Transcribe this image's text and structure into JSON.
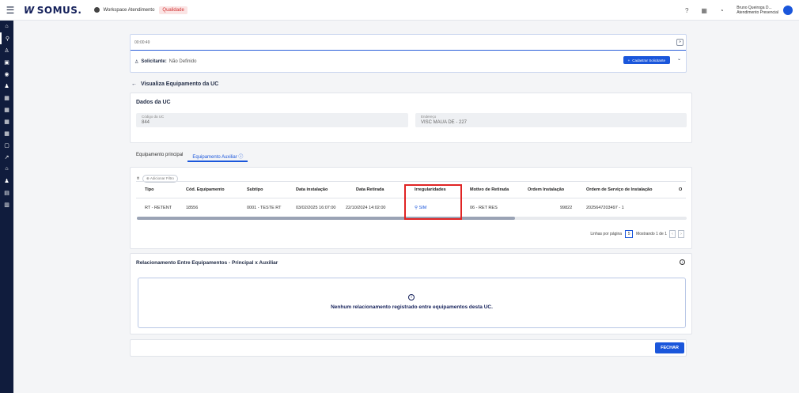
{
  "topbar": {
    "logo_mark": "W",
    "logo_text": "SOMUS.",
    "workspace": "Workspace Atendimento",
    "badge": "Qualidade",
    "user_name": "Bruno Queiroga D...",
    "user_role": "Atendimento Presencial"
  },
  "sidebar": {
    "icons": [
      "home-icon",
      "search-icon",
      "users-icon",
      "clipboard-icon",
      "money-icon",
      "people-icon",
      "grid-icon",
      "grid-icon",
      "grid-icon",
      "grid-icon",
      "document-icon",
      "route-icon",
      "home-icon",
      "people-icon",
      "list-icon",
      "card-icon"
    ]
  },
  "timer": {
    "value": "00:00:49"
  },
  "solicitante": {
    "label": "Solicitante:",
    "value": "Não Definido",
    "button": "Cadastrar Solicitante"
  },
  "page": {
    "title": "Visualiza Equipamento da UC"
  },
  "dados": {
    "title": "Dados da UC",
    "codigo_label": "Código da UC",
    "codigo_value": "844",
    "endereco_label": "Endereço",
    "endereco_value": "VISC MAUA DE - 227"
  },
  "tabs": {
    "principal": "Equipamento principal",
    "auxiliar": "Equipamento Auxiliar"
  },
  "table": {
    "filter_label": "Adicionar Filtro",
    "headers": [
      "Tipo",
      "Cód. Equipamento",
      "Subtipo",
      "Data instalação",
      "Data Retirada",
      "Irregularidades",
      "Motivo de Retirada",
      "Ordem Instalação",
      "Ordem de Serviço de Instalação",
      "O"
    ],
    "row": {
      "tipo": "RT - RETENT",
      "codigo": "18556",
      "subtipo": "0001 - TESTE RT",
      "data_instalacao": "03/02/2025 16:07:00",
      "data_retirada": "22/10/2024 14:02:00",
      "irregularidades": "SIM",
      "motivo": "06 - RET RES",
      "ordem_instalacao": "99822",
      "ordem_servico": "2025647203497 - 1"
    },
    "rows_per_page_label": "Linhas por página",
    "rows_per_page": "5",
    "showing": "Mostrando 1 de 1"
  },
  "relacionamento": {
    "title": "Relacionamento Entre Equipamentos - Principal x Auxiliar",
    "empty_message": "Nenhum relacionamento registrado entre equipamentos desta UC."
  },
  "footer": {
    "close_button": "FECHAR"
  }
}
